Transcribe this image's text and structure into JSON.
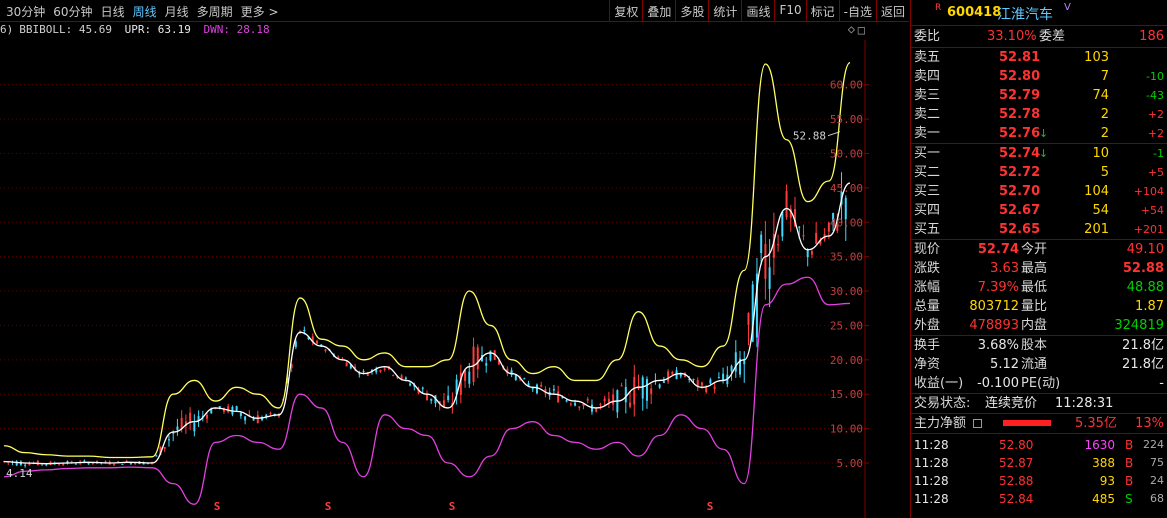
{
  "toolbar": {
    "periods": [
      "30分钟",
      "60分钟",
      "日线",
      "周线",
      "月线",
      "多周期",
      "更多 >"
    ],
    "active_period": "周线",
    "buttons": [
      "复权",
      "叠加",
      "多股",
      "统计",
      "画线",
      "F10",
      "标记",
      "-自选",
      "返回"
    ]
  },
  "indicator": {
    "prefix": "6)",
    "name": "BBIBOLL: 45.69",
    "upr": "UPR: 63.19",
    "dwn": "DWN: 28.18",
    "ctrl_diamond": "◇",
    "ctrl_box": "□"
  },
  "chart_data": {
    "type": "line",
    "yaxis_ticks": [
      "60.00",
      "55.00",
      "50.00",
      "45.00",
      "40.00",
      "35.00",
      "30.00",
      "25.00",
      "20.00",
      "15.00",
      "10.00",
      "5.00"
    ],
    "ylim": [
      -3,
      66.5
    ],
    "annot_high": "52.88",
    "annot_low": "4.14",
    "s_marker": "S",
    "x": [
      0,
      1,
      2,
      3,
      4,
      5,
      6,
      7,
      8,
      9,
      10,
      11,
      12,
      13,
      14,
      15,
      16,
      17,
      18,
      19,
      20,
      21,
      22,
      23,
      24,
      25,
      26,
      27,
      28,
      29,
      30,
      31,
      32,
      33,
      34,
      35,
      36,
      37,
      38,
      39,
      40
    ],
    "series": [
      {
        "name": "BBIBOLL",
        "color": "#ffffff",
        "values": [
          5.2,
          5.0,
          4.9,
          5.0,
          5.1,
          5.0,
          5.1,
          5.0,
          9.5,
          11,
          13,
          12.5,
          11.5,
          12,
          24,
          22,
          20,
          18,
          19,
          17,
          15,
          13,
          19,
          21,
          18,
          16,
          15,
          14,
          13,
          14,
          16,
          17,
          18,
          16,
          17,
          20,
          35,
          42,
          36,
          38,
          45.7
        ]
      },
      {
        "name": "UPR",
        "color": "#ffff60",
        "values": [
          7.5,
          6.5,
          6.2,
          6.0,
          6.0,
          5.8,
          5.8,
          5.9,
          15,
          17,
          14,
          16,
          15,
          13,
          29,
          23,
          22,
          20,
          21,
          19,
          19,
          20,
          30,
          25,
          20,
          18,
          19,
          17,
          17,
          20,
          27,
          22,
          20,
          19,
          22,
          33,
          63,
          52,
          43,
          46,
          63.2
        ]
      },
      {
        "name": "DWN",
        "color": "#e040e0",
        "values": [
          3.0,
          3.8,
          4.0,
          4.2,
          4.3,
          4.3,
          4.4,
          4.3,
          2.0,
          -1.0,
          8.0,
          9.0,
          8.0,
          7.0,
          15,
          13,
          8,
          3,
          12,
          10,
          9,
          5,
          3,
          6,
          10,
          11,
          9,
          8,
          7,
          8,
          6,
          9,
          12,
          10,
          7,
          2,
          28,
          31,
          32,
          28,
          28.2
        ]
      }
    ]
  },
  "quote": {
    "code": "600418",
    "name": "江淮汽车",
    "r_mark": "R",
    "v_mark": "V",
    "weibi_label": "委比",
    "weibi": "33.10%",
    "weicha_label": "委差",
    "weicha": "186",
    "asks": [
      {
        "label": "卖五",
        "price": "52.81",
        "vol": "103",
        "chg": ""
      },
      {
        "label": "卖四",
        "price": "52.80",
        "vol": "7",
        "chg": "-10"
      },
      {
        "label": "卖三",
        "price": "52.79",
        "vol": "74",
        "chg": "-43"
      },
      {
        "label": "卖二",
        "price": "52.78",
        "vol": "2",
        "chg": "+2"
      },
      {
        "label": "卖一",
        "price": "52.76",
        "vol": "2",
        "chg": "+2"
      }
    ],
    "bids": [
      {
        "label": "买一",
        "price": "52.74",
        "vol": "10",
        "chg": "-1"
      },
      {
        "label": "买二",
        "price": "52.72",
        "vol": "5",
        "chg": "+5"
      },
      {
        "label": "买三",
        "price": "52.70",
        "vol": "104",
        "chg": "+104"
      },
      {
        "label": "买四",
        "price": "52.67",
        "vol": "54",
        "chg": "+54"
      },
      {
        "label": "买五",
        "price": "52.65",
        "vol": "201",
        "chg": "+201"
      }
    ],
    "stats": [
      {
        "l1": "现价",
        "v1": "52.74",
        "l2": "今开",
        "v2": "49.10"
      },
      {
        "l1": "涨跌",
        "v1": "3.63",
        "l2": "最高",
        "v2": "52.88"
      },
      {
        "l1": "涨幅",
        "v1": "7.39%",
        "l2": "最低",
        "v2": "48.88"
      },
      {
        "l1": "总量",
        "v1": "803712",
        "l2": "量比",
        "v2": "1.87"
      },
      {
        "l1": "外盘",
        "v1": "478893",
        "l2": "内盘",
        "v2": "324819"
      }
    ],
    "extra": [
      {
        "l1": "换手",
        "v1": "3.68%",
        "l2": "股本",
        "v2": "21.8亿"
      },
      {
        "l1": "净资",
        "v1": "5.12",
        "l2": "流通",
        "v2": "21.8亿"
      },
      {
        "l1": "收益(一)",
        "v1": "-0.100",
        "l2": "PE(动)",
        "v2": "-"
      }
    ],
    "status_label": "交易状态:",
    "status_value": "连续竞价",
    "status_time": "11:28:31",
    "mainflow_label": "主力净额",
    "mainflow_value": "5.35亿",
    "mainflow_pct": "13%",
    "trades": [
      {
        "time": "11:28",
        "price": "52.80",
        "vol": "1630",
        "side": "B",
        "n": "224"
      },
      {
        "time": "11:28",
        "price": "52.87",
        "vol": "388",
        "side": "B",
        "n": "75"
      },
      {
        "time": "11:28",
        "price": "52.88",
        "vol": "93",
        "side": "B",
        "n": "24"
      },
      {
        "time": "11:28",
        "price": "52.84",
        "vol": "485",
        "side": "S",
        "n": "68"
      }
    ]
  }
}
